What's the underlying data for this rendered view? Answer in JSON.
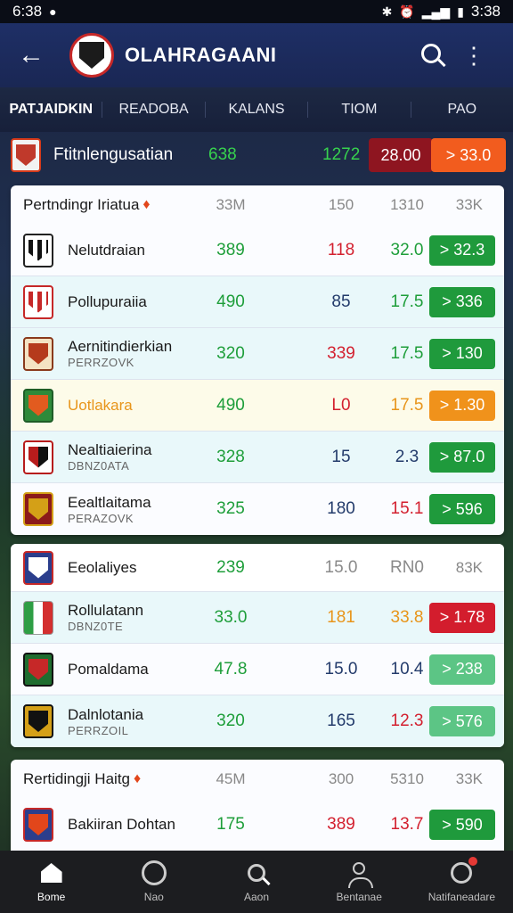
{
  "status_bar": {
    "time_left": "6:38",
    "time_right": "3:38"
  },
  "app_bar": {
    "title": "OLAHRAGAANI"
  },
  "tabs": [
    {
      "label": "PATJAIDKIN",
      "active": true
    },
    {
      "label": "READOBA",
      "active": false
    },
    {
      "label": "KALANS",
      "active": false
    },
    {
      "label": "TIOM",
      "active": false
    },
    {
      "label": "PAO",
      "active": false
    }
  ],
  "featured": {
    "name": "Ftitnlengusatian",
    "v1": "638",
    "v2": "1272",
    "v3": "28.00",
    "pill": "> 33.0"
  },
  "group1": {
    "header": {
      "title": "Pertndingr Iriatua",
      "c1": "33M",
      "c2": "150",
      "c3": "1310",
      "c4": "33K"
    },
    "rows": [
      {
        "name": "Nelutdraian",
        "sub": "",
        "v1": "389",
        "v2": "118",
        "v3": "32.0",
        "pill": "> 32.3"
      },
      {
        "name": "Pollupuraiia",
        "sub": "",
        "v1": "490",
        "v2": "85",
        "v3": "17.5",
        "pill": "> 336"
      },
      {
        "name": "Aernitindierkian",
        "sub": "PERRZOVK",
        "v1": "320",
        "v2": "339",
        "v3": "17.5",
        "pill": "> 130"
      },
      {
        "name": "Uotlakara",
        "sub": "",
        "v1": "490",
        "v2": "L0",
        "v3": "17.5",
        "pill": "> 1.30"
      },
      {
        "name": "Nealtiaierina",
        "sub": "DBNZ0ATA",
        "v1": "328",
        "v2": "15",
        "v3": "2.3",
        "pill": "> 87.0"
      },
      {
        "name": "Eealtlaitama",
        "sub": "PERAZOVK",
        "v1": "325",
        "v2": "180",
        "v3": "15.1",
        "pill": "> 596"
      }
    ]
  },
  "group2": {
    "header": {
      "name": "Eeolaliyes",
      "c1": "239",
      "c2": "15.0",
      "c3": "RN0",
      "c4": "83K"
    },
    "rows": [
      {
        "name": "Rollulatann",
        "sub": "DBNZ0TE",
        "v1": "33.0",
        "v2": "181",
        "v3": "33.8",
        "pill": "> 1.78"
      },
      {
        "name": "Pomaldama",
        "sub": "",
        "v1": "47.8",
        "v2": "15.0",
        "v3": "10.4",
        "pill": "> 238"
      },
      {
        "name": "Dalnlotania",
        "sub": "PERRZOIL",
        "v1": "320",
        "v2": "165",
        "v3": "12.3",
        "pill": "> 576"
      }
    ]
  },
  "group3": {
    "header": {
      "title": "Rertidingji Haitg",
      "c1": "45M",
      "c2": "300",
      "c3": "5310",
      "c4": "33K"
    },
    "rows": [
      {
        "name": "Bakiiran Dohtan",
        "sub": "",
        "v1": "175",
        "v2": "389",
        "v3": "13.7",
        "pill": "> 590"
      }
    ]
  },
  "bottom_nav": [
    {
      "label": "Bome",
      "icon": "home-icon"
    },
    {
      "label": "Nao",
      "icon": "ball-icon"
    },
    {
      "label": "Aaon",
      "icon": "search-icon"
    },
    {
      "label": "Bentanae",
      "icon": "profile-icon"
    },
    {
      "label": "Natifaneadare",
      "icon": "notifications-icon"
    }
  ]
}
